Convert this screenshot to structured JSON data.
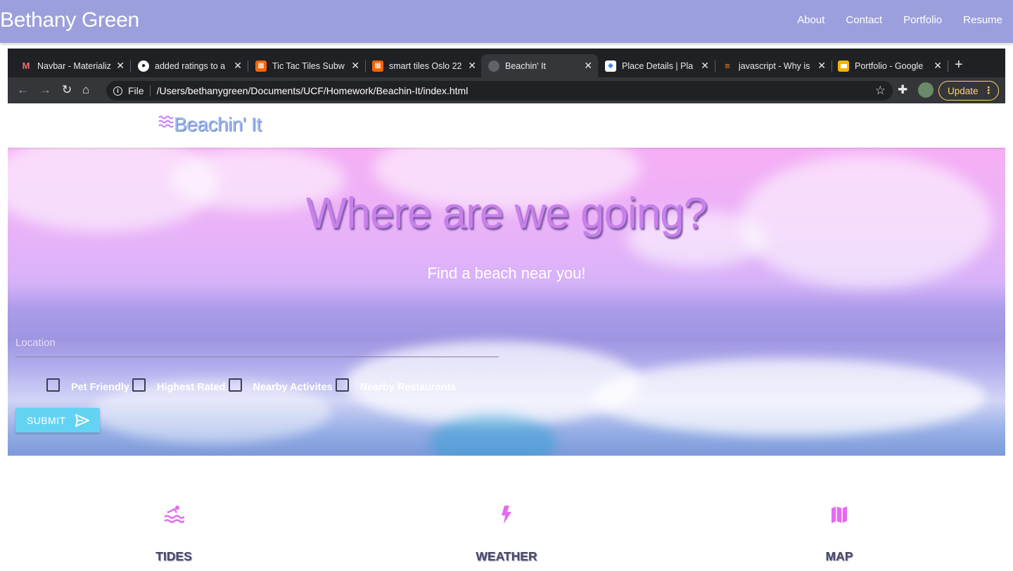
{
  "site": {
    "brand": "Bethany Green",
    "links": [
      "About",
      "Contact",
      "Portfolio",
      "Resume"
    ]
  },
  "browser": {
    "tabs": [
      {
        "title": "Navbar - Materializ",
        "favicon_color": "#ee6e73"
      },
      {
        "title": "added ratings to a",
        "favicon_color": "#ffffff"
      },
      {
        "title": "Tic Tac Tiles Subw",
        "favicon_color": "#f96302"
      },
      {
        "title": "smart tiles Oslo 22",
        "favicon_color": "#f96302"
      },
      {
        "title": "Beachin' It",
        "favicon_color": "#5f6368"
      },
      {
        "title": "Place Details | Pla",
        "favicon_color": "#4285f4"
      },
      {
        "title": "javascript - Why is",
        "favicon_color": "#f48024"
      },
      {
        "title": "Portfolio - Google",
        "favicon_color": "#f4b400"
      }
    ],
    "active_tab": 4,
    "address_scheme": "File",
    "address_url": "/Users/bethanygreen/Documents/UCF/Homework/Beachin-It/index.html",
    "update_label": "Update"
  },
  "app": {
    "logo_text": "Beachin' It",
    "hero_title": "Where are we going?",
    "hero_subtitle": "Find a beach near you!",
    "location_placeholder": "Location",
    "filters": [
      "Pet Friendly",
      "Highest Rated",
      "Nearby Activites",
      "Nearby Restaurants"
    ],
    "submit_label": "SUBMIT",
    "features": [
      {
        "label": "TIDES",
        "icon": "pool-icon"
      },
      {
        "label": "WEATHER",
        "icon": "lightning-icon"
      },
      {
        "label": "MAP",
        "icon": "map-icon"
      }
    ]
  },
  "colors": {
    "site_nav": "#9b9fdc",
    "accent_purple": "#c780ec",
    "submit_cyan": "#64d3f3",
    "icon_pink": "#e56af2"
  }
}
